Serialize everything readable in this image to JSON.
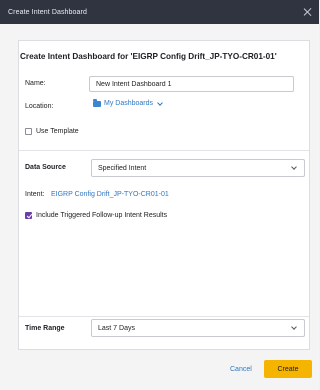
{
  "dialog": {
    "title": "Create Intent Dashboard",
    "heading": "Create Intent Dashboard for 'EIGRP Config Drift_JP-TYO-CR01-01'"
  },
  "form": {
    "name_label": "Name:",
    "name_value": "New Intent Dashboard 1",
    "location_label": "Location:",
    "location_value": "My Dashboards",
    "use_template_label": "Use Template",
    "use_template_checked": false,
    "data_source_label": "Data Source",
    "data_source_value": "Specified Intent",
    "intent_label": "Intent:",
    "intent_value": "EIGRP Config Drift_JP-TYO-CR01-01",
    "include_triggered_label": "Include Triggered Follow-up Intent Results",
    "include_triggered_checked": true,
    "time_range_label": "Time Range",
    "time_range_value": "Last 7 Days"
  },
  "footer": {
    "cancel_label": "Cancel",
    "create_label": "Create"
  },
  "colors": {
    "titlebar": "#2f3440",
    "link": "#2f78c4",
    "primary_button": "#f5b400",
    "checkbox_checked": "#6b3fa8"
  }
}
